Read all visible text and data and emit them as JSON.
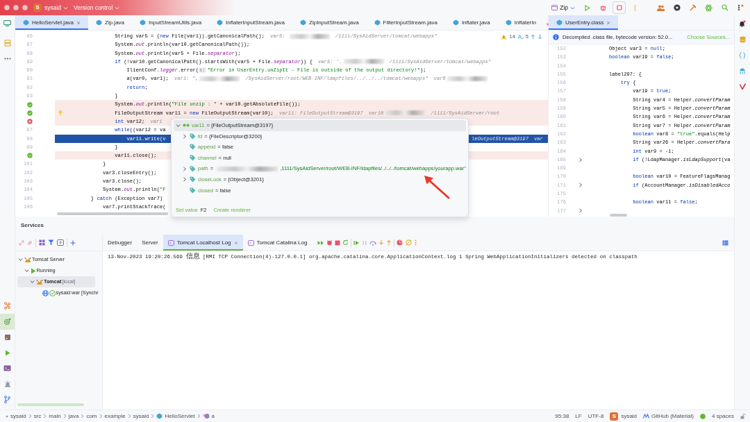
{
  "title_bar": {
    "project_badge": "S",
    "project": "sysaid",
    "vcs": "Version control",
    "run_config": "Zip"
  },
  "editor_tabs": [
    {
      "label": "HelloServlet.java",
      "selected": true
    },
    {
      "label": "Zip.java",
      "selected": false
    },
    {
      "label": "InputStreamUtils.java",
      "selected": false
    },
    {
      "label": "InflaterInputStream.java",
      "selected": false
    },
    {
      "label": "ZipInputStream.java",
      "selected": false
    },
    {
      "label": "FilterInputStream.java",
      "selected": false
    },
    {
      "label": "Inflater.java",
      "selected": false
    },
    {
      "label": "InflaterIn",
      "selected": false
    }
  ],
  "editor": {
    "warnings": "14",
    "typos": "5",
    "lines": [
      {
        "num": "86",
        "kind": "plain",
        "code": [
          {
            "kind": "plain",
            "text": "                    String var5 = ("
          },
          {
            "kind": "keyword",
            "text": "new"
          },
          {
            "kind": "plain",
            "text": " File(var1)).getCanonicalPath();"
          }
        ],
        "hints": [
          {
            "kind": "hint",
            "text": "var5: "
          },
          {
            "kind": "blur"
          },
          {
            "kind": "hint",
            "text": "/1111/SysAidServer/tomcat/webapps\""
          }
        ]
      },
      {
        "num": "87",
        "kind": "plain",
        "code": [
          {
            "kind": "plain",
            "text": "                    System."
          },
          {
            "kind": "field",
            "text": "out"
          },
          {
            "kind": "plain",
            "text": ".println(var10.getCanonicalPath());"
          }
        ]
      },
      {
        "num": "88",
        "kind": "plain",
        "code": [
          {
            "kind": "plain",
            "text": "                    System."
          },
          {
            "kind": "field",
            "text": "out"
          },
          {
            "kind": "plain",
            "text": ".println(var5 + File."
          },
          {
            "kind": "field",
            "text": "separator"
          },
          {
            "kind": "plain",
            "text": ");"
          }
        ]
      },
      {
        "num": "89",
        "kind": "plain",
        "code": [
          {
            "kind": "keyword",
            "text": "                    if"
          },
          {
            "kind": "plain",
            "text": " (!var10.getCanonicalPath().startsWith(var5 + File."
          },
          {
            "kind": "field",
            "text": "separator"
          },
          {
            "kind": "plain",
            "text": ")) {"
          }
        ],
        "hints": [
          {
            "kind": "hint",
            "text": "var5: '."
          },
          {
            "kind": "blur"
          },
          {
            "kind": "hint",
            "text": "/1111/SysAidServer/tomcat/webapps\""
          }
        ]
      },
      {
        "num": "90",
        "kind": "plain",
        "code": [
          {
            "kind": "plain",
            "text": "                        IlientConf."
          },
          {
            "kind": "field",
            "text": "logger"
          },
          {
            "kind": "plain",
            "text": ".error("
          },
          {
            "kind": "param",
            "text": "s:"
          },
          {
            "kind": "string",
            "text": "\"Error in UserEntry.unZipIt - File is outside of the output directory!\""
          },
          {
            "kind": "plain",
            "text": ");"
          }
        ]
      },
      {
        "num": "91",
        "kind": "plain",
        "code": [
          {
            "kind": "method",
            "text": "                        a"
          },
          {
            "kind": "plain",
            "text": "(var0, var1);"
          }
        ],
        "hints": [
          {
            "kind": "hint",
            "text": "var1: \","
          },
          {
            "kind": "blur"
          },
          {
            "kind": "hint",
            "text": "/SysAidServer/root/WEB-INF/ldapfiles/../../../tomcat/webapps\""
          },
          {
            "kind": "hint",
            "text": "var6"
          },
          {
            "kind": "blur"
          }
        ]
      },
      {
        "num": "92",
        "kind": "plain",
        "code": [
          {
            "kind": "keyword",
            "text": "                        return"
          },
          {
            "kind": "plain",
            "text": ";"
          }
        ]
      },
      {
        "num": "93",
        "kind": "plain",
        "code": [
          {
            "kind": "plain",
            "text": "                    }"
          }
        ]
      },
      {
        "kind": "breakpoint",
        "code": [
          {
            "kind": "plain",
            "text": "                    System."
          },
          {
            "kind": "field",
            "text": "out"
          },
          {
            "kind": "plain",
            "text": ".println("
          },
          {
            "kind": "string",
            "text": "\"File unzip : \""
          },
          {
            "kind": "plain",
            "text": " + var10.getAbsoluteFile());"
          }
        ]
      },
      {
        "kind": "breakpoint",
        "bulb": true,
        "code": [
          {
            "kind": "plain",
            "text": "                    FileOutputStream var11 = "
          },
          {
            "kind": "keyword",
            "text": "new"
          },
          {
            "kind": "plain",
            "text": " FileOutputStream(var10);"
          }
        ],
        "hints": [
          {
            "kind": "hint",
            "text": "var11: FileOutputStream@3197"
          },
          {
            "kind": "hint",
            "text": "var10"
          },
          {
            "kind": "blur"
          },
          {
            "kind": "hint",
            "text": "/1111/SysAidServer/root"
          }
        ]
      },
      {
        "kind": "invalid-breakpoint",
        "code": [
          {
            "kind": "keyword",
            "text": "                    int"
          },
          {
            "kind": "plain",
            "text": " var12;"
          }
        ],
        "hints": [
          {
            "kind": "hint",
            "text": "var1"
          }
        ]
      },
      {
        "num": "97",
        "kind": "plain",
        "code": [
          {
            "kind": "keyword",
            "text": "                    while"
          },
          {
            "kind": "plain",
            "text": "((var12 = va"
          }
        ]
      },
      {
        "num": "98",
        "kind": "execution",
        "code": [
          {
            "kind": "plain",
            "text": "                        var11.write(v"
          }
        ],
        "tail": [
          {
            "kind": "hint",
            "text": "leOutputStream@3197"
          },
          {
            "kind": "hint",
            "text": "var"
          }
        ]
      },
      {
        "num": "99",
        "kind": "plain",
        "code": [
          {
            "kind": "plain",
            "text": "                    }"
          }
        ]
      },
      {
        "kind": "breakpoint",
        "code": [
          {
            "kind": "plain",
            "text": "                    var11.close();"
          }
        ]
      },
      {
        "num": "101",
        "kind": "plain",
        "code": [
          {
            "kind": "plain",
            "text": "                }"
          }
        ]
      },
      {
        "num": "102",
        "kind": "plain",
        "code": [
          {
            "kind": "plain",
            "text": "                var3.closeEntry();"
          }
        ]
      },
      {
        "num": "103",
        "kind": "plain",
        "code": [
          {
            "kind": "plain",
            "text": "                var3.close();"
          }
        ]
      },
      {
        "num": "104",
        "kind": "plain",
        "code": [
          {
            "kind": "plain",
            "text": "                System."
          },
          {
            "kind": "field",
            "text": "out"
          },
          {
            "kind": "plain",
            "text": ".println("
          },
          {
            "kind": "string",
            "text": "\"F"
          }
        ]
      },
      {
        "num": "105",
        "kind": "plain",
        "code": [
          {
            "kind": "plain",
            "text": "            } "
          },
          {
            "kind": "keyword",
            "text": "catch"
          },
          {
            "kind": "plain",
            "text": " (Exception var7)"
          }
        ]
      },
      {
        "num": "106",
        "kind": "plain",
        "code": [
          {
            "kind": "plain",
            "text": "                var7.printStackTrace("
          }
        ]
      }
    ]
  },
  "right_editor": {
    "tab": {
      "label": "UserEntry.class",
      "selected": true
    },
    "banner": {
      "message": "Decompiled .class file, bytecode version: 52.0...",
      "action": "Choose Sources..."
    },
    "lines": [
      {
        "num": "152",
        "fold": false,
        "code": [
          {
            "kind": "plain",
            "text": "        Object var3 = "
          },
          {
            "kind": "keyword",
            "text": "null"
          },
          {
            "kind": "plain",
            "text": ";"
          }
        ]
      },
      {
        "num": "153",
        "fold": false,
        "code": [
          {
            "kind": "keyword",
            "text": "        boolean"
          },
          {
            "kind": "plain",
            "text": " var19 = "
          },
          {
            "kind": "keyword",
            "text": "false"
          },
          {
            "kind": "plain",
            "text": ";"
          }
        ]
      },
      {
        "num": "154",
        "fold": false
      },
      {
        "num": "155",
        "fold": false,
        "code": [
          {
            "kind": "plain",
            "text": "        label297: {"
          }
        ]
      },
      {
        "num": "156",
        "fold": false,
        "code": [
          {
            "kind": "keyword",
            "text": "            try"
          },
          {
            "kind": "plain",
            "text": " {"
          }
        ]
      },
      {
        "num": "157",
        "fold": false,
        "code": [
          {
            "kind": "plain",
            "text": "                var19 = "
          },
          {
            "kind": "keyword",
            "text": "true"
          },
          {
            "kind": "plain",
            "text": ";"
          }
        ]
      },
      {
        "num": "158",
        "fold": false,
        "code": [
          {
            "kind": "plain",
            "text": "                String var4 = Helper."
          },
          {
            "kind": "method",
            "text": "convertParam"
          }
        ]
      },
      {
        "num": "159",
        "fold": false,
        "code": [
          {
            "kind": "plain",
            "text": "                String var5 = Helper."
          },
          {
            "kind": "method",
            "text": "convertParam"
          }
        ]
      },
      {
        "num": "160",
        "fold": false,
        "code": [
          {
            "kind": "plain",
            "text": "                String var6 = Helper."
          },
          {
            "kind": "method",
            "text": "convertParam"
          }
        ]
      },
      {
        "num": "161",
        "fold": false,
        "code": [
          {
            "kind": "plain",
            "text": "                String var7 = Helper."
          },
          {
            "kind": "method",
            "text": "convertParam"
          }
        ]
      },
      {
        "num": "162",
        "fold": false,
        "code": [
          {
            "kind": "keyword",
            "text": "                boolean"
          },
          {
            "kind": "plain",
            "text": " var8 = "
          },
          {
            "kind": "string",
            "text": "\"true\""
          },
          {
            "kind": "plain",
            "text": ".equals(Help"
          }
        ]
      },
      {
        "num": "163",
        "fold": false,
        "code": [
          {
            "kind": "plain",
            "text": "                String var26 = Helper."
          },
          {
            "kind": "method",
            "text": "convertPara"
          }
        ]
      },
      {
        "num": "164",
        "fold": false,
        "code": [
          {
            "kind": "keyword",
            "text": "                int"
          },
          {
            "kind": "plain",
            "text": " var9 = -1;"
          }
        ]
      },
      {
        "num": "165",
        "fold": true,
        "code": [
          {
            "kind": "keyword",
            "text": "                if"
          },
          {
            "kind": "plain",
            "text": " (!LdapManager."
          },
          {
            "kind": "method",
            "text": "isLdapSupport"
          },
          {
            "kind": "plain",
            "text": "(va"
          }
        ]
      },
      {
        "num": "169",
        "fold": false
      },
      {
        "num": "170",
        "fold": false,
        "code": [
          {
            "kind": "keyword",
            "text": "                boolean"
          },
          {
            "kind": "plain",
            "text": " var10 = FeatureFlagsManag"
          }
        ]
      },
      {
        "num": "171",
        "fold": true,
        "code": [
          {
            "kind": "keyword",
            "text": "                if"
          },
          {
            "kind": "plain",
            "text": " (AccountManager."
          },
          {
            "kind": "method",
            "text": "isDisabledAcco"
          }
        ]
      },
      {
        "num": "175",
        "fold": false
      },
      {
        "num": "176",
        "fold": false,
        "code": [
          {
            "kind": "keyword",
            "text": "                boolean"
          },
          {
            "kind": "plain",
            "text": " var11 = "
          },
          {
            "kind": "keyword",
            "text": "false"
          },
          {
            "kind": "plain",
            "text": ";"
          }
        ]
      },
      {
        "num": "177",
        "fold": true
      }
    ]
  },
  "debug_popup": {
    "root": {
      "name": "var11",
      "value": "= {FileOutputStream@3197}",
      "expanded": true,
      "children": [
        {
          "name": "fd",
          "value": "= {FileDescriptor@3200}",
          "kind": "object",
          "expandable": true,
          "redacted": false
        },
        {
          "name": "append",
          "value": "= false",
          "kind": "literal",
          "expandable": false,
          "redacted": false
        },
        {
          "name": "channel",
          "value": "= null",
          "kind": "literal",
          "expandable": false,
          "redacted": false
        },
        {
          "name": "path",
          "value": "=",
          "string": ",1111/SysAidServer/root/WEB-INF/ldapfiles/../../../tomcat/webapps/yourapp.war\"",
          "kind": "string",
          "expandable": true,
          "redacted": true
        },
        {
          "name": "closeLock",
          "value": "= {Object@3201}",
          "kind": "object",
          "expandable": true,
          "redacted": false
        },
        {
          "name": "closed",
          "value": "= false",
          "kind": "literal",
          "expandable": false,
          "redacted": false
        }
      ]
    },
    "footer": {
      "action": "Set value",
      "shortcut": "F2",
      "link": "Create renderer"
    }
  },
  "services": {
    "title": "Services",
    "tree": [
      {
        "label": "Tomcat Server",
        "kind": "server",
        "expanded": true,
        "selected": false,
        "emphasized": false,
        "children": [
          {
            "label": "Running",
            "kind": "group",
            "expanded": true,
            "selected": false,
            "emphasized": false,
            "children": [
              {
                "label": "Tomcat",
                "suffix": "[local]",
                "kind": "server",
                "expanded": true,
                "selected": true,
                "emphasized": true,
                "children": [
                  {
                    "label": "sysaid:war [Synchr",
                    "kind": "artifact",
                    "selected": false,
                    "emphasized": false
                  }
                ]
              }
            ]
          }
        ]
      }
    ],
    "tabs": [
      {
        "label": "Debugger",
        "selected": false,
        "icon": false
      },
      {
        "label": "Server",
        "selected": false,
        "icon": false
      },
      {
        "label": "Tomcat Localhost Log",
        "selected": true,
        "icon": true
      },
      {
        "label": "Tomcat Catalina Log",
        "selected": false,
        "icon": true
      }
    ],
    "log": [
      {
        "text": "13-Nov-2023 19:20:26.569 ",
        "cjk": "信息",
        "rest": " [RMI TCP Connection(4)-127.0.0.1] org.apache.catalina.core.ApplicationContext.log 1 Spring WebApplicationInitializers detected on classpath"
      }
    ]
  },
  "breadcrumbs": [
    {
      "label": "sysaid",
      "kind": "folder"
    },
    {
      "label": "src",
      "kind": "folder"
    },
    {
      "label": "main",
      "kind": "folder"
    },
    {
      "label": "java",
      "kind": "folder"
    },
    {
      "label": "com",
      "kind": "folder"
    },
    {
      "label": "example",
      "kind": "folder"
    },
    {
      "label": "sysaid",
      "kind": "folder"
    },
    {
      "label": "HelloServlet",
      "kind": "class"
    },
    {
      "label": "a",
      "kind": "method"
    }
  ],
  "status_bar": {
    "position": "95:38",
    "line_ending": "LF",
    "encoding": "UTF-8",
    "project_badge": "S",
    "project": "sysaid",
    "theme": "GitHub (Material)",
    "indent": "4 spaces"
  }
}
